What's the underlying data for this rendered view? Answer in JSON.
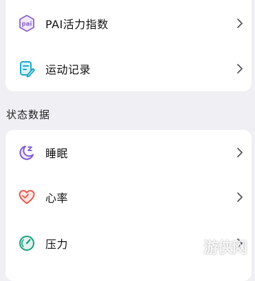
{
  "top_card": {
    "items": [
      {
        "label": "PAI活力指数",
        "icon": "pai-icon",
        "icon_color": "#8b63c9"
      },
      {
        "label": "运动记录",
        "icon": "exercise-record-icon",
        "icon_color": "#1aa8c8"
      }
    ]
  },
  "status_section": {
    "title": "状态数据",
    "items": [
      {
        "label": "睡眠",
        "icon": "sleep-icon",
        "icon_color": "#7d5bd6"
      },
      {
        "label": "心率",
        "icon": "heart-icon",
        "icon_color": "#e9574b"
      },
      {
        "label": "压力",
        "icon": "stress-gauge-icon",
        "icon_color": "#1a9c7c"
      }
    ]
  },
  "watermark": {
    "text": "游侠网"
  },
  "colors": {
    "background": "#efeff4",
    "card": "#ffffff",
    "chevron": "#555555"
  }
}
